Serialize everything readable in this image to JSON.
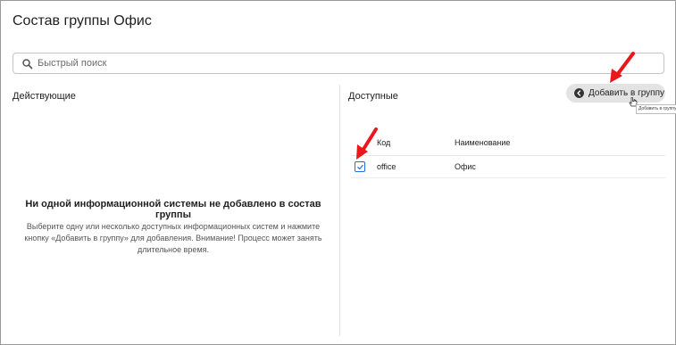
{
  "page": {
    "title": "Состав группы Офис"
  },
  "search": {
    "placeholder": "Быстрый поиск",
    "icon": "search-icon"
  },
  "left_panel": {
    "title": "Действующие",
    "empty_title": "Ни одной информационной системы не добавлено в состав группы",
    "empty_desc_lines": [
      "Выберите одну или несколько доступных информационных систем и нажмите",
      "кнопку «Добавить в группу» для добавления. Внимание! Процесс может занять",
      "длительное время."
    ]
  },
  "right_panel": {
    "title": "Доступные",
    "add_button": {
      "label": "Добавить в группу",
      "icon": "circle-arrow-left-icon",
      "tooltip": "Добавить в группу"
    },
    "table": {
      "columns": [
        "Код",
        "Наименование"
      ],
      "rows": [
        {
          "code": "office",
          "name": "Офис",
          "checked": true
        }
      ]
    }
  },
  "annotations": {
    "arrow_color": "#e8181b"
  },
  "colors": {
    "accent": "#1e6fd9",
    "button_bg": "#e3e3e3"
  }
}
